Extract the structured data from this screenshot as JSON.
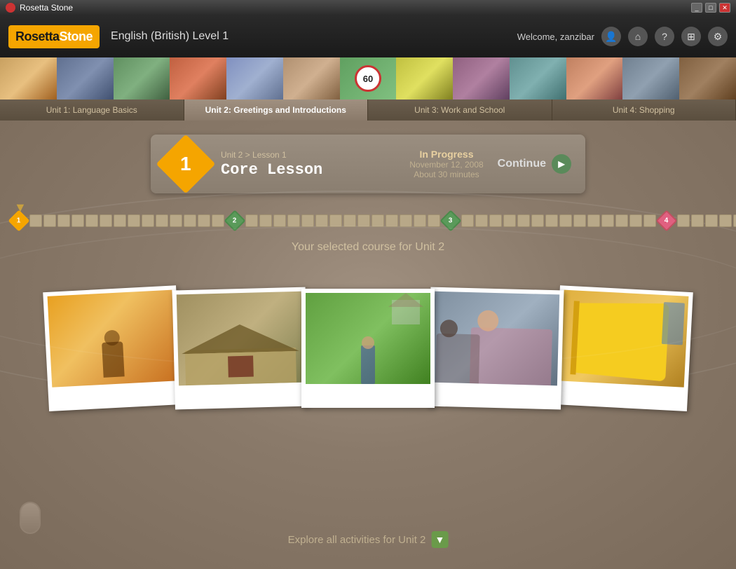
{
  "titlebar": {
    "app_name": "Rosetta Stone",
    "controls": [
      "minimize",
      "maximize",
      "close"
    ]
  },
  "header": {
    "logo": "RosettaStone",
    "course_title": "English (British) Level 1",
    "welcome_text": "Welcome, zanzibar",
    "icons": [
      "user-icon",
      "home-icon",
      "help-icon",
      "grid-icon",
      "settings-icon"
    ]
  },
  "unit_tabs": [
    {
      "id": "unit1",
      "label": "Unit 1: Language Basics",
      "active": false
    },
    {
      "id": "unit2",
      "label": "Unit 2: Greetings and Introductions",
      "active": true
    },
    {
      "id": "unit3",
      "label": "Unit 3: Work and School",
      "active": false
    },
    {
      "id": "unit4",
      "label": "Unit 4: Shopping",
      "active": false
    }
  ],
  "lesson_banner": {
    "number": "1",
    "breadcrumb": "Unit 2 > Lesson 1",
    "title": "Core Lesson",
    "status_label": "In Progress",
    "date": "November 12, 2008",
    "duration": "About 30 minutes",
    "continue_label": "Continue"
  },
  "timeline": {
    "nodes": [
      {
        "type": "diamond-orange",
        "label": "1"
      },
      {
        "type": "squares",
        "count": 14
      },
      {
        "type": "diamond-green",
        "label": "2"
      },
      {
        "type": "squares",
        "count": 14
      },
      {
        "type": "diamond-green",
        "label": "3"
      },
      {
        "type": "squares",
        "count": 14
      },
      {
        "type": "diamond-pink",
        "label": "4"
      },
      {
        "type": "squares",
        "count": 14
      },
      {
        "type": "circle-yellow"
      }
    ]
  },
  "course_text": "Your selected course for Unit 2",
  "explore_label": "Explore all activities for Unit 2",
  "photos": [
    {
      "alt": "Child with flashlight in tent",
      "color": "photo-1"
    },
    {
      "alt": "Thatched roof cottage",
      "color": "photo-2"
    },
    {
      "alt": "Child in garden",
      "color": "photo-3"
    },
    {
      "alt": "Woman and child outdoors",
      "color": "photo-4"
    },
    {
      "alt": "Yellow book",
      "color": "photo-5"
    }
  ]
}
